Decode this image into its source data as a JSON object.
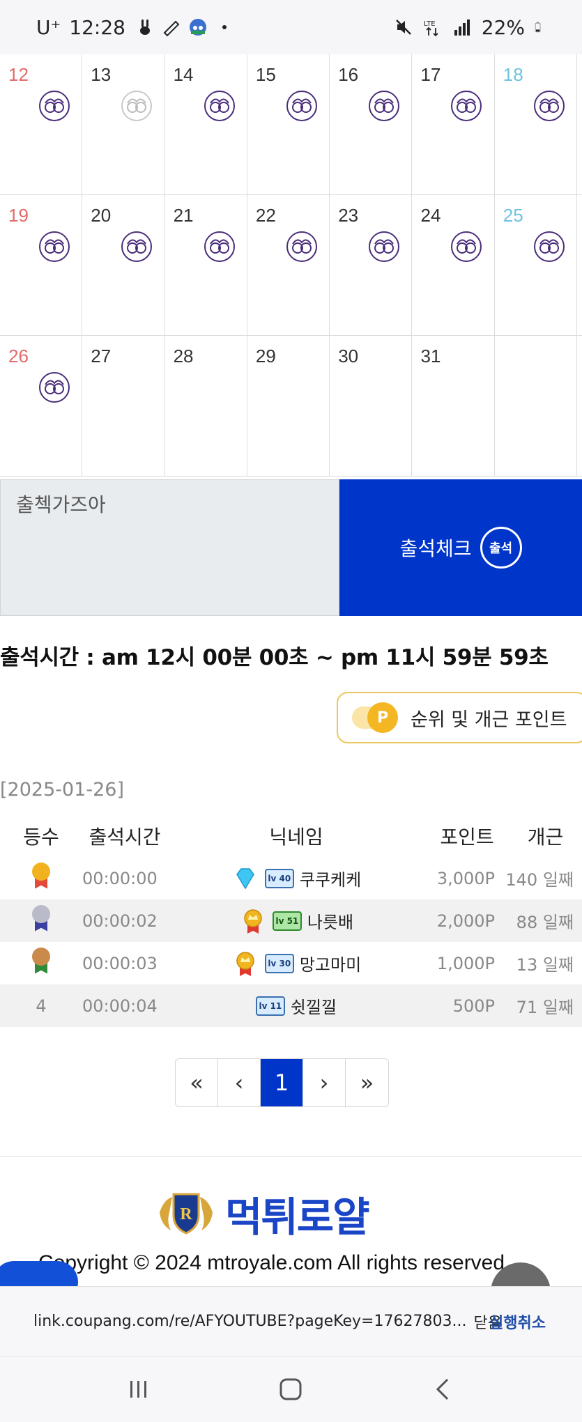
{
  "status_bar": {
    "carrier": "U⁺",
    "time": "12:28",
    "battery": "22%"
  },
  "calendar": {
    "rows": [
      [
        {
          "day": "12",
          "type": "sun",
          "stamp": "on"
        },
        {
          "day": "13",
          "type": "",
          "stamp": "faded"
        },
        {
          "day": "14",
          "type": "",
          "stamp": "on"
        },
        {
          "day": "15",
          "type": "",
          "stamp": "on"
        },
        {
          "day": "16",
          "type": "",
          "stamp": "on"
        },
        {
          "day": "17",
          "type": "",
          "stamp": "on"
        },
        {
          "day": "18",
          "type": "sat",
          "stamp": "on"
        }
      ],
      [
        {
          "day": "19",
          "type": "sun",
          "stamp": "on"
        },
        {
          "day": "20",
          "type": "",
          "stamp": "on"
        },
        {
          "day": "21",
          "type": "",
          "stamp": "on"
        },
        {
          "day": "22",
          "type": "",
          "stamp": "on"
        },
        {
          "day": "23",
          "type": "",
          "stamp": "on"
        },
        {
          "day": "24",
          "type": "",
          "stamp": "on"
        },
        {
          "day": "25",
          "type": "sat",
          "stamp": "on"
        }
      ],
      [
        {
          "day": "26",
          "type": "sun",
          "stamp": "on"
        },
        {
          "day": "27",
          "type": "",
          "stamp": ""
        },
        {
          "day": "28",
          "type": "",
          "stamp": ""
        },
        {
          "day": "29",
          "type": "",
          "stamp": ""
        },
        {
          "day": "30",
          "type": "",
          "stamp": ""
        },
        {
          "day": "31",
          "type": "",
          "stamp": ""
        },
        {
          "day": "",
          "type": "",
          "stamp": ""
        }
      ]
    ]
  },
  "attendance": {
    "input_value": "출첵가즈아",
    "button_label": "출석체크",
    "badge_label": "출석",
    "time_text": "출석시간 : am 12시 00분 00초 ~ pm 11시 59분 59초",
    "rank_button_label": "순위 및 개근 포인트",
    "coin_label": "P"
  },
  "ranking": {
    "date": "[2025-01-26]",
    "headers": {
      "rank": "등수",
      "time": "출석시간",
      "nick": "닉네임",
      "point": "포인트",
      "days": "개근"
    },
    "rows": [
      {
        "rank": "",
        "medal": "gold",
        "time": "00:00:00",
        "deco": "diamond",
        "level": "40",
        "level_color": "blue",
        "nick": "쿠쿠케케",
        "point": "3,000P",
        "days": "140 일째"
      },
      {
        "rank": "",
        "medal": "silver",
        "time": "00:00:02",
        "deco": "crown",
        "level": "51",
        "level_color": "green",
        "nick": "나릇배",
        "point": "2,000P",
        "days": "88 일째"
      },
      {
        "rank": "",
        "medal": "bronze",
        "time": "00:00:03",
        "deco": "crown",
        "level": "30",
        "level_color": "blue",
        "nick": "망고마미",
        "point": "1,000P",
        "days": "13 일째"
      },
      {
        "rank": "4",
        "medal": "",
        "time": "00:00:04",
        "deco": "",
        "level": "11",
        "level_color": "blue",
        "nick": "쉿낄낄",
        "point": "500P",
        "days": "71 일째"
      }
    ]
  },
  "pagination": {
    "first": "«",
    "prev": "‹",
    "current": "1",
    "next": "›",
    "last": "»"
  },
  "footer": {
    "logo_text": "먹튀로얄",
    "copyright": "Copyright © 2024 mtroyale.com All rights reserved."
  },
  "link_bar": {
    "url": "link.coupang.com/re/AFYOUTUBE?pageKey=17627803...",
    "close": "닫음",
    "cancel": "실행취소"
  },
  "colors": {
    "primary": "#0035c9",
    "sunday": "#e36a6a",
    "saturday": "#6fc3e0",
    "stamp": "#4a2d7a"
  }
}
